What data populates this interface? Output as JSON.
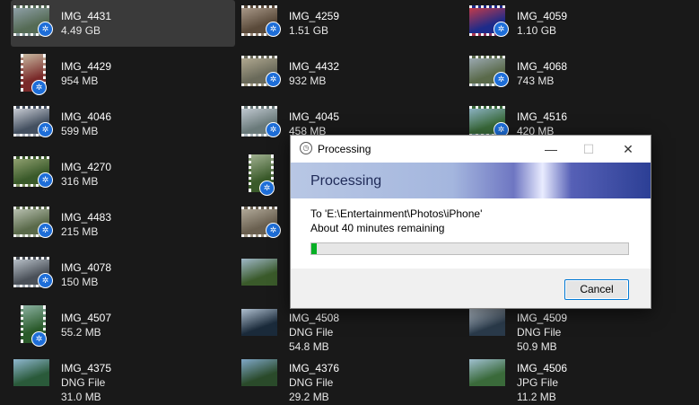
{
  "colors": {
    "background": "#191919",
    "selected": "#3a3a3a",
    "badge": "#1e6ed8",
    "progress": "#06b025"
  },
  "files": [
    {
      "name": "IMG_4431",
      "lines": [
        "4.49 GB"
      ],
      "type": "video",
      "shape": "land",
      "selected": true,
      "colors": [
        "#556b55",
        "#8fa0a8"
      ]
    },
    {
      "name": "IMG_4259",
      "lines": [
        "1.51 GB"
      ],
      "type": "video",
      "shape": "land",
      "colors": [
        "#5a4a3a",
        "#a89888"
      ]
    },
    {
      "name": "IMG_4059",
      "lines": [
        "1.10 GB"
      ],
      "type": "video",
      "shape": "land",
      "colors": [
        "#1d2b8a",
        "#c23a4a"
      ]
    },
    {
      "name": "IMG_4429",
      "lines": [
        "954 MB"
      ],
      "type": "video",
      "shape": "port",
      "colors": [
        "#7a2a2a",
        "#c8b8a0"
      ]
    },
    {
      "name": "IMG_4432",
      "lines": [
        "932 MB"
      ],
      "type": "video",
      "shape": "land",
      "colors": [
        "#6a6a5a",
        "#b0a890"
      ]
    },
    {
      "name": "IMG_4068",
      "lines": [
        "743 MB"
      ],
      "type": "video",
      "shape": "land",
      "colors": [
        "#5a6a4a",
        "#9aa8b0"
      ]
    },
    {
      "name": "IMG_4046",
      "lines": [
        "599 MB"
      ],
      "type": "video",
      "shape": "land",
      "colors": [
        "#445060",
        "#c8ccd4"
      ]
    },
    {
      "name": "IMG_4045",
      "lines": [
        "458 MB"
      ],
      "type": "video",
      "shape": "land",
      "colors": [
        "#6a7a7a",
        "#c0c8d0"
      ]
    },
    {
      "name": "IMG_4516",
      "lines": [
        "420 MB"
      ],
      "type": "video",
      "shape": "land",
      "colors": [
        "#3a6a3a",
        "#8ab0c0"
      ]
    },
    {
      "name": "IMG_4270",
      "lines": [
        "316 MB"
      ],
      "type": "video",
      "shape": "land",
      "colors": [
        "#3a5a2a",
        "#90a070"
      ]
    },
    {
      "name": "",
      "lines": [],
      "type": "video",
      "shape": "port",
      "colors": [
        "#3a5a2a",
        "#a0b090"
      ]
    },
    {
      "name": "",
      "lines": [],
      "type": "none",
      "shape": "land",
      "colors": [
        "#000",
        "#000"
      ]
    },
    {
      "name": "IMG_4483",
      "lines": [
        "215 MB"
      ],
      "type": "video",
      "shape": "land",
      "colors": [
        "#5a6a4a",
        "#b8c0b0"
      ]
    },
    {
      "name": "",
      "lines": [],
      "type": "video",
      "shape": "land",
      "colors": [
        "#6a6050",
        "#b0a898"
      ]
    },
    {
      "name": "",
      "lines": [],
      "type": "none",
      "shape": "land",
      "colors": [
        "#000",
        "#000"
      ]
    },
    {
      "name": "IMG_4078",
      "lines": [
        "150 MB"
      ],
      "type": "video",
      "shape": "land",
      "colors": [
        "#4a5058",
        "#b8c0c8"
      ]
    },
    {
      "name": "",
      "lines": [],
      "type": "photo",
      "shape": "land",
      "colors": [
        "#3a5a2a",
        "#a0b8c8"
      ]
    },
    {
      "name": "",
      "lines": [],
      "type": "none",
      "shape": "land",
      "colors": [
        "#000",
        "#000"
      ]
    },
    {
      "name": "IMG_4507",
      "lines": [
        "55.2 MB"
      ],
      "type": "video",
      "shape": "port",
      "colors": [
        "#2a5a2a",
        "#8ab0a0"
      ]
    },
    {
      "name": "IMG_4508",
      "lines": [
        "DNG File",
        "54.8 MB"
      ],
      "type": "photo",
      "shape": "land",
      "colors": [
        "#1a2a3a",
        "#b0c0d0"
      ]
    },
    {
      "name": "IMG_4509",
      "lines": [
        "DNG File",
        "50.9 MB"
      ],
      "type": "photo",
      "shape": "land",
      "colors": [
        "#2a3a4a",
        "#c0ccd8"
      ]
    },
    {
      "name": "IMG_4375",
      "lines": [
        "DNG File",
        "31.0 MB"
      ],
      "type": "photo",
      "shape": "land",
      "colors": [
        "#2a5a3a",
        "#90b8d0"
      ]
    },
    {
      "name": "IMG_4376",
      "lines": [
        "DNG File",
        "29.2 MB"
      ],
      "type": "photo",
      "shape": "land",
      "colors": [
        "#2a4a2a",
        "#80a8c8"
      ]
    },
    {
      "name": "IMG_4506",
      "lines": [
        "JPG File",
        "11.2 MB"
      ],
      "type": "photo",
      "shape": "land",
      "colors": [
        "#3a6a3a",
        "#a0c0d0"
      ]
    }
  ],
  "dialog": {
    "title": "Processing",
    "heading": "Processing",
    "destination": "To 'E:\\Entertainment\\Photos\\iPhone'",
    "remaining": "About 40 minutes remaining",
    "progress": 0.018,
    "cancel_label": "Cancel",
    "minimize_glyph": "—",
    "maximize_glyph": "☐",
    "close_glyph": "✕",
    "clock_glyph": "◷"
  }
}
